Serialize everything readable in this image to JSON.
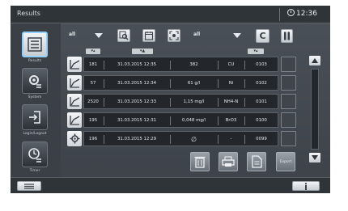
{
  "window": {
    "title": "Results",
    "clock": "12:36"
  },
  "sidebar": {
    "items": [
      {
        "label": "Results",
        "icon": "results-list-icon",
        "active": true
      },
      {
        "label": "System",
        "icon": "system-gear-icon",
        "active": false
      },
      {
        "label": "Login/Logout",
        "icon": "login-logout-icon",
        "active": false
      },
      {
        "label": "Timer",
        "icon": "timer-icon",
        "active": false
      }
    ]
  },
  "toolbar": {
    "filter_1": "all",
    "filter_2": "all",
    "clear_label": "C"
  },
  "table": {
    "rows": [
      {
        "icon": "measurement-chart-icon",
        "id": "181",
        "datetime": "31.03.2015 12:35",
        "value": "382",
        "parameter": "CU",
        "code": "0103"
      },
      {
        "icon": "measurement-chart-icon",
        "id": "57",
        "datetime": "31.03.2015 12:34",
        "value": "61 g/l",
        "parameter": "Ni",
        "code": "0102"
      },
      {
        "icon": "measurement-chart-icon",
        "id": "2520",
        "datetime": "31.03.2015 12:33",
        "value": "1,15 mg/l",
        "parameter": "NH4-N",
        "code": "0101"
      },
      {
        "icon": "measurement-chart-icon",
        "id": "195",
        "datetime": "31.03.2015 12:31",
        "value": "0,048 mg/l",
        "parameter": "BrO3",
        "code": "0100"
      },
      {
        "icon": "settings-cog-icon",
        "id": "196",
        "datetime": "31.03.2015 12:29",
        "value": "∅",
        "parameter": "-",
        "code": "0099"
      }
    ]
  },
  "actions": {
    "export_label": "Export"
  },
  "colors": {
    "background": "#464c52",
    "highlight": "#8fd0ff",
    "button": "#e6e9ec"
  }
}
